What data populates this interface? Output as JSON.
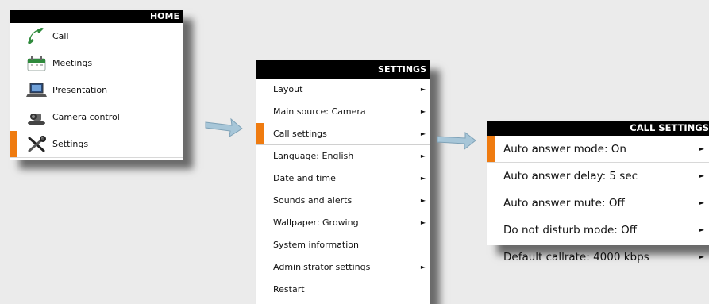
{
  "home": {
    "title": "HOME",
    "items": [
      {
        "label": "Call",
        "icon": "phone-icon"
      },
      {
        "label": "Meetings",
        "icon": "calendar-icon"
      },
      {
        "label": "Presentation",
        "icon": "laptop-icon"
      },
      {
        "label": "Camera control",
        "icon": "camera-icon"
      },
      {
        "label": "Settings",
        "icon": "tools-icon",
        "selected": true
      }
    ]
  },
  "settings": {
    "title": "SETTINGS",
    "items": [
      {
        "label": "Layout",
        "has_submenu": true
      },
      {
        "label": "Main source: Camera",
        "has_submenu": true
      },
      {
        "label": "Call settings",
        "has_submenu": true,
        "selected": true
      },
      {
        "label": "Language: English",
        "has_submenu": true
      },
      {
        "label": "Date and time",
        "has_submenu": true
      },
      {
        "label": "Sounds and alerts",
        "has_submenu": true
      },
      {
        "label": "Wallpaper: Growing",
        "has_submenu": true
      },
      {
        "label": "System information",
        "has_submenu": false
      },
      {
        "label": "Administrator settings",
        "has_submenu": true
      },
      {
        "label": "Restart",
        "has_submenu": false
      }
    ]
  },
  "call_settings": {
    "title": "CALL SETTINGS",
    "items": [
      {
        "label": "Auto answer mode: On",
        "has_submenu": true,
        "selected": true
      },
      {
        "label": "Auto answer delay: 5 sec",
        "has_submenu": true
      },
      {
        "label": "Auto answer mute: Off",
        "has_submenu": true
      },
      {
        "label": "Do not disturb mode: Off",
        "has_submenu": true
      },
      {
        "label": "Default callrate: 4000 kbps",
        "has_submenu": true
      }
    ]
  },
  "chevron_glyph": "►",
  "colors": {
    "accent": "#ef7b10",
    "header": "#000000",
    "arrow": "#a7c6d8"
  }
}
